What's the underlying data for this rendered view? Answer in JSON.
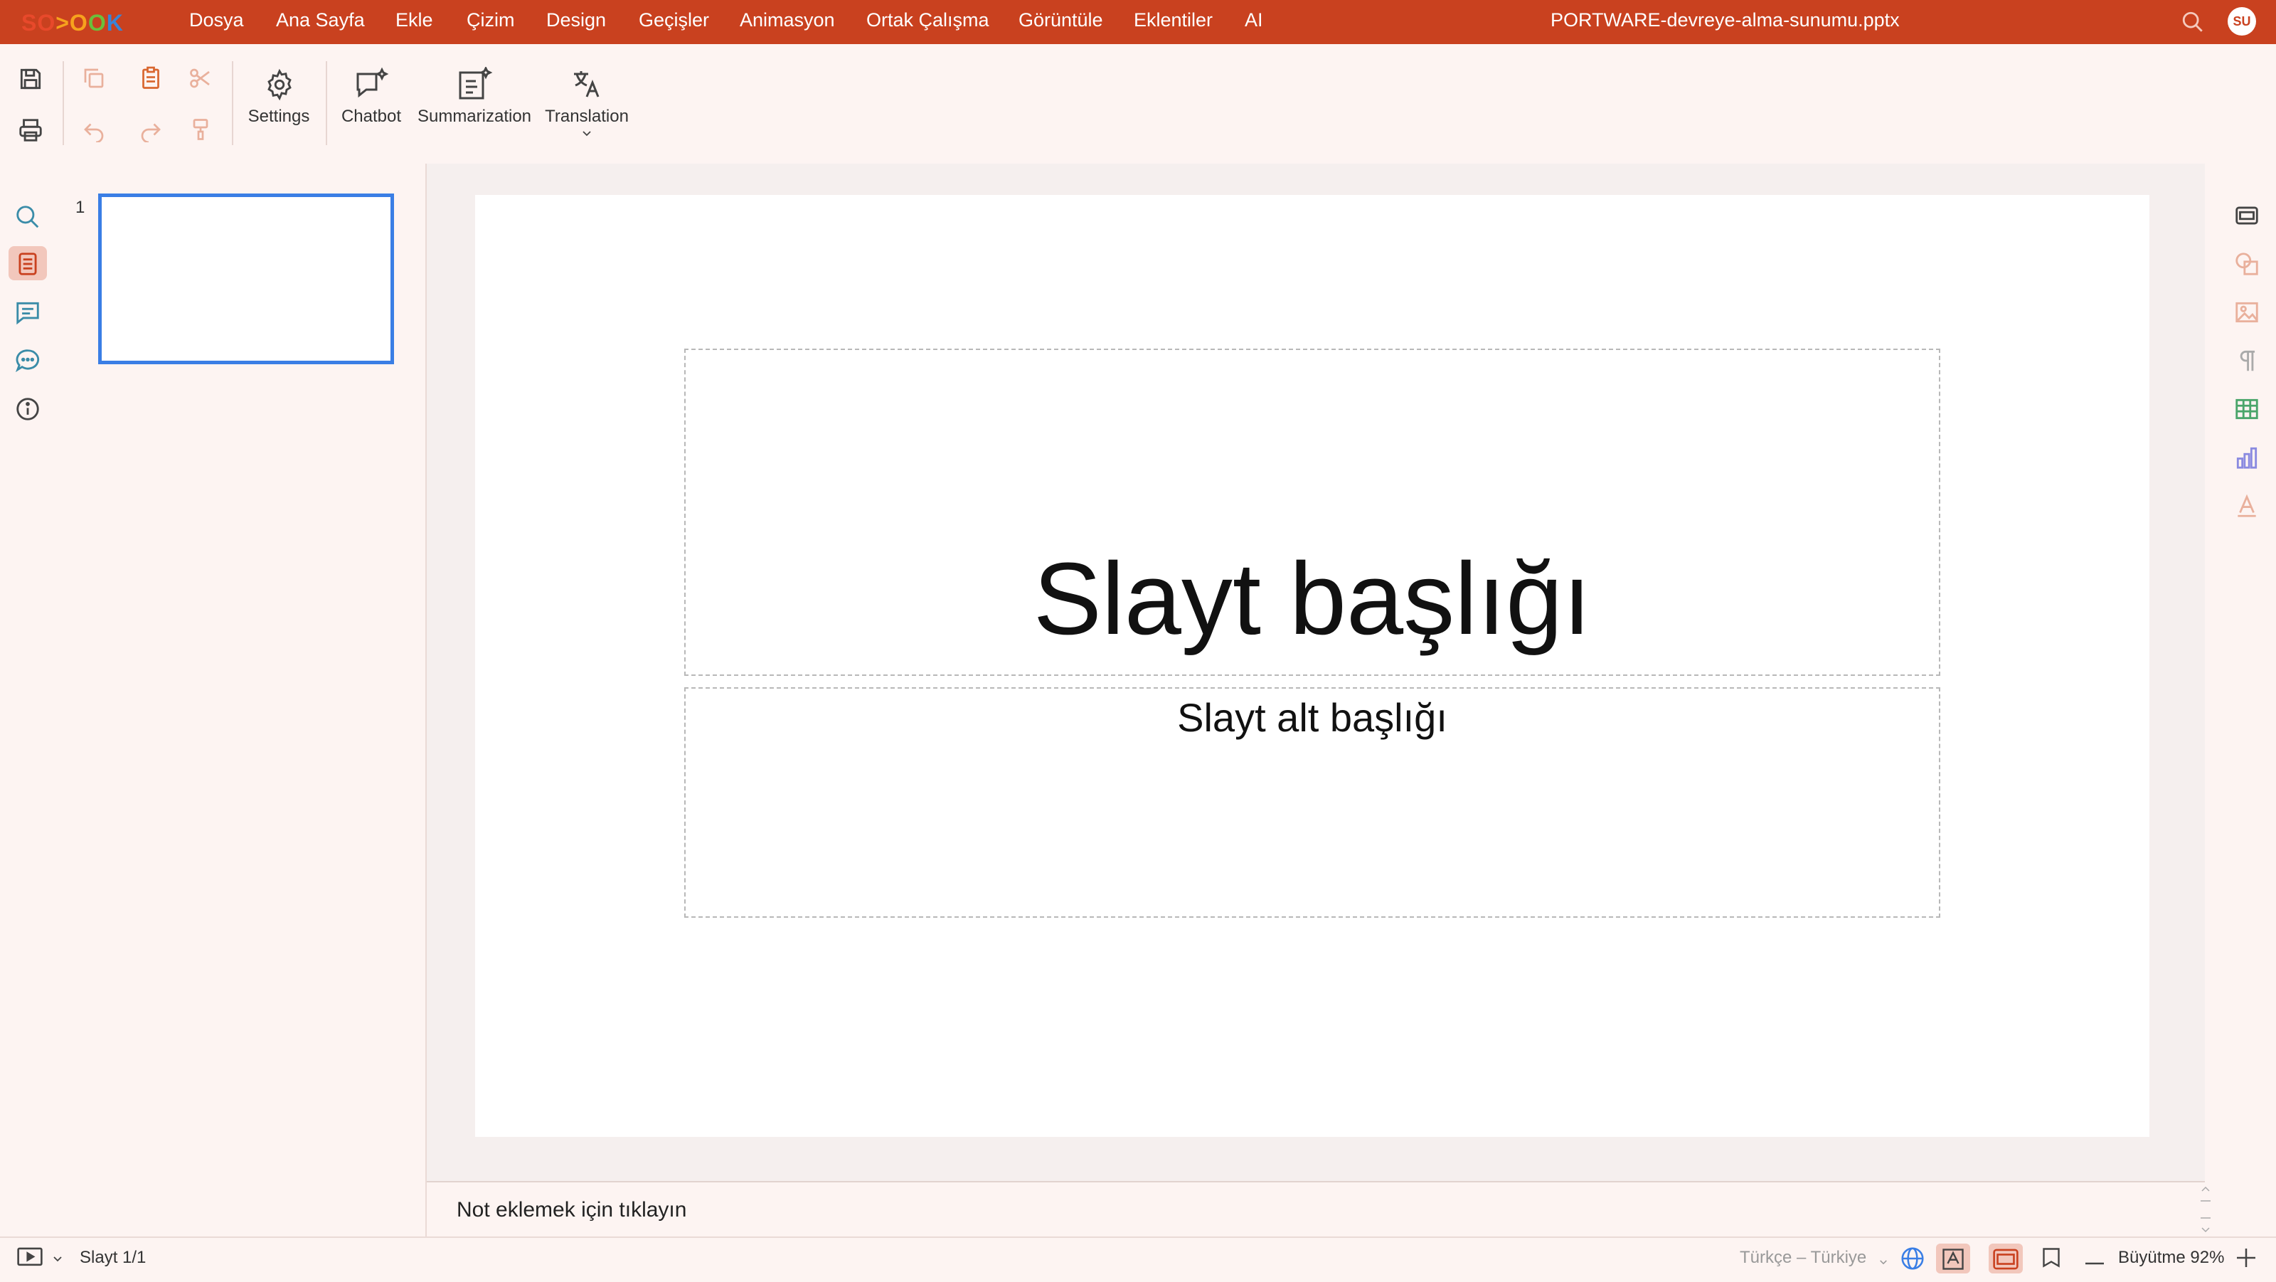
{
  "app": {
    "logo_letters": [
      "S",
      "O",
      ">",
      "O",
      "O",
      "K"
    ],
    "logo_colors": [
      "#e8492b",
      "#e8492b",
      "#f7a21d",
      "#f7a21d",
      "#6bbf3b",
      "#3a84d6"
    ]
  },
  "menu": {
    "items": [
      "Dosya",
      "Ana Sayfa",
      "Ekle",
      "Çizim",
      "Design",
      "Geçişler",
      "Animasyon",
      "Ortak Çalışma",
      "Görüntüle",
      "Eklentiler",
      "AI"
    ]
  },
  "document": {
    "title": "PORTWARE-devreye-alma-sunumu.pptx"
  },
  "user": {
    "initials": "SU"
  },
  "ribbon": {
    "settings_label": "Settings",
    "chatbot_label": "Chatbot",
    "summarization_label": "Summarization",
    "translation_label": "Translation"
  },
  "thumbnails": {
    "items": [
      {
        "number": "1"
      }
    ]
  },
  "slide": {
    "title": "Slayt başlığı",
    "subtitle": "Slayt alt başlığı"
  },
  "notes": {
    "placeholder": "Not eklemek için tıklayın"
  },
  "status": {
    "slide_counter": "Slayt 1/1",
    "language": "Türkçe – Türkiye",
    "zoom_label": "Büyütme 92%"
  },
  "colors": {
    "accent": "#c9411f",
    "selection_border": "#3a7ee5",
    "ribbon_bg": "#fdf4f2"
  }
}
